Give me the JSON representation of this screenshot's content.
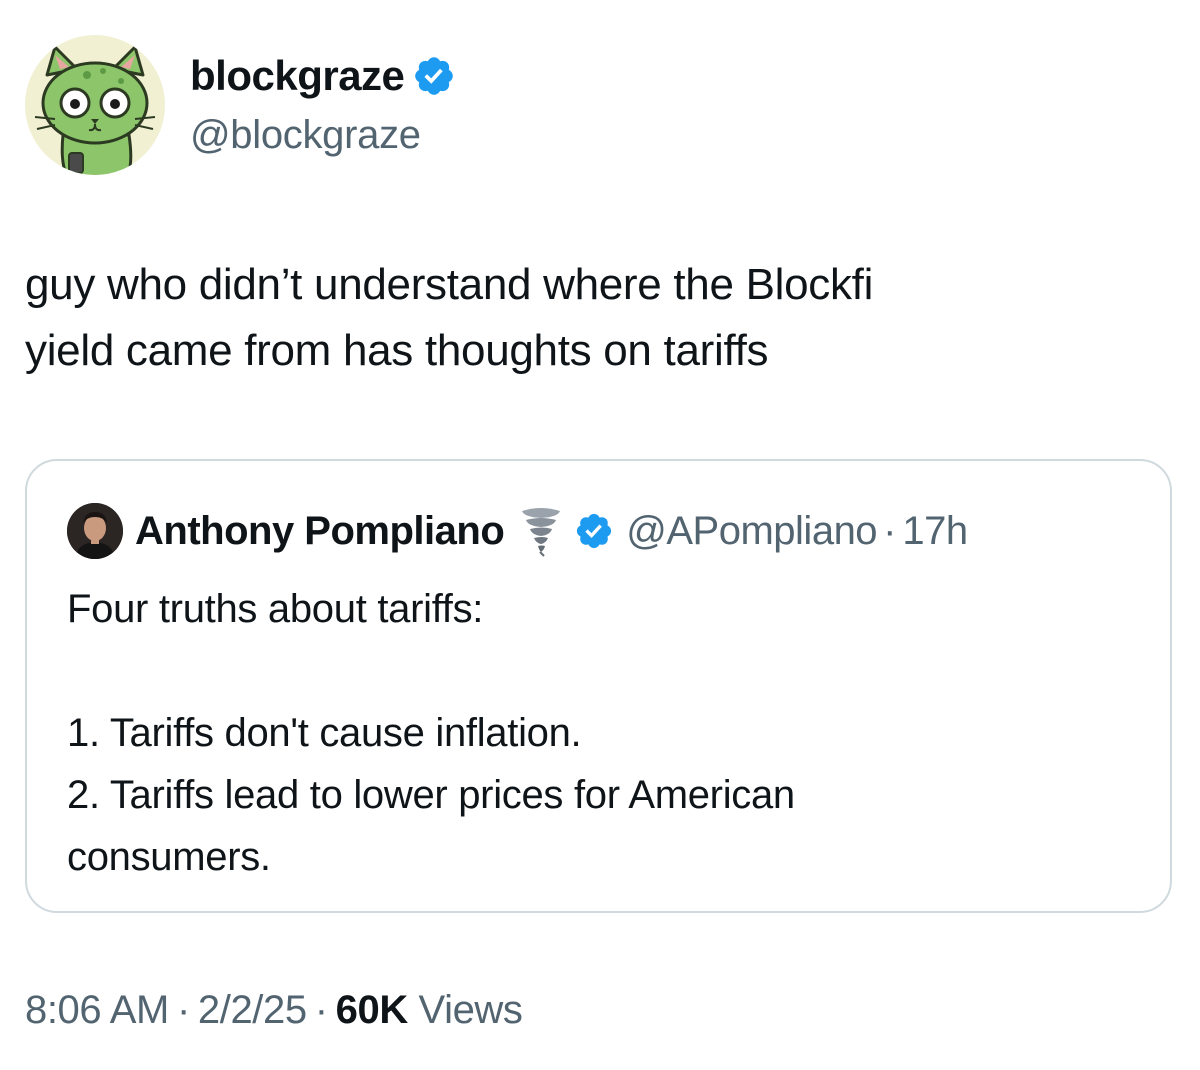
{
  "author": {
    "display_name": "blockgraze",
    "handle": "@blockgraze",
    "avatar_icon": "green-cat-avatar",
    "verified_color": "#1d9bf0"
  },
  "tweet": {
    "lines": [
      "guy who didn’t understand where the Blockfi",
      "yield came from has thoughts on tariffs"
    ]
  },
  "quote": {
    "display_name": "Anthony Pompliano",
    "emoji_icon": "tornado-icon",
    "handle": "@APompliano",
    "separator": "·",
    "time": "17h",
    "lines": [
      "Four truths about tariffs:",
      "",
      "1. Tariffs don't cause inflation.",
      "2. Tariffs lead to lower prices for American",
      "consumers."
    ]
  },
  "meta": {
    "time": "8:06 AM",
    "separator": "·",
    "date": "2/2/25",
    "views_count": "60K",
    "views_label": "Views"
  },
  "colors": {
    "text_primary": "#0f1419",
    "text_secondary": "#536471",
    "border": "#cfd9de",
    "verified": "#1d9bf0"
  }
}
